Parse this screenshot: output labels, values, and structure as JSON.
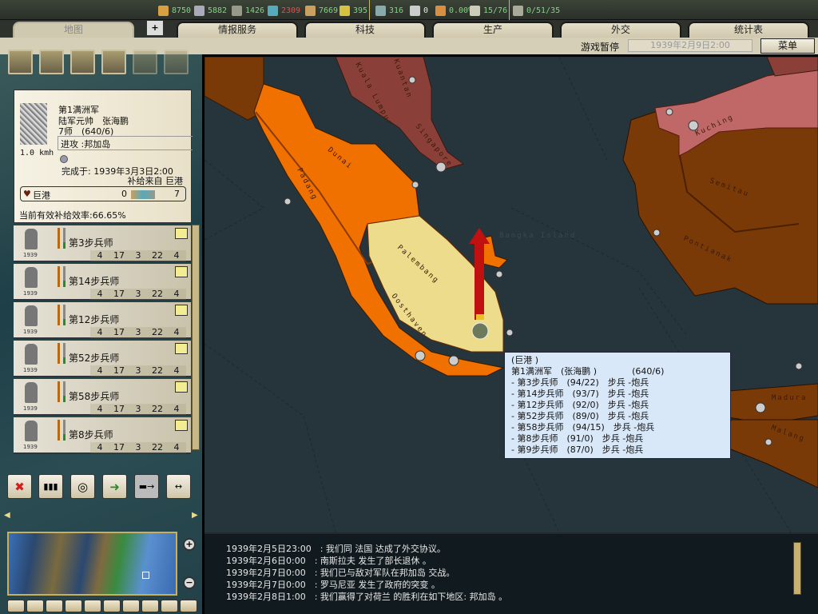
{
  "resources": [
    {
      "icon": "energy-icon",
      "value": "8750",
      "color": "#7fd67f"
    },
    {
      "icon": "metal-icon",
      "value": "5882",
      "color": "#7fd67f"
    },
    {
      "icon": "rare-materials-icon",
      "value": "1426",
      "color": "#7fd67f"
    },
    {
      "icon": "oil-icon",
      "value": "2309",
      "color": "#e05050"
    },
    {
      "icon": "supplies-icon",
      "value": "7669",
      "color": "#7fd67f"
    },
    {
      "icon": "money-icon",
      "value": "395",
      "color": "#7fd67f"
    },
    {
      "icon": "manpower-icon",
      "value": "316",
      "color": "#7fd67f"
    },
    {
      "icon": "transports-icon",
      "value": "0",
      "color": "#e8e8e8"
    },
    {
      "icon": "dissent-icon",
      "value": "0.00%",
      "color": "#7fd67f"
    },
    {
      "icon": "convoy-icon",
      "value": "15/76",
      "color": "#7fd67f"
    },
    {
      "icon": "nuke-icon",
      "value": "0/51/35",
      "color": "#7fd67f"
    }
  ],
  "tabs": [
    "地图",
    "情报服务",
    "科技",
    "生产",
    "外交",
    "统计表"
  ],
  "status": {
    "paused": "游戏暂停",
    "date": "1939年2月9日2:00",
    "menu": "菜单"
  },
  "unit": {
    "name": "第1满洲军",
    "rank_leader": "陆军元帅　张海鹏",
    "divisions": "7师　(640/6)",
    "mission": "进攻 :邦加岛",
    "speed": "1.0 kmh",
    "complete": "完成于: 1939年3月3日2:00",
    "supply_from": "补给来自 巨港",
    "province": "巨港",
    "supply_left": "0",
    "supply_right": "7",
    "efficiency": "当前有效补给效率:66.65%"
  },
  "division_list": [
    {
      "name": "第3步兵师",
      "year": "1939",
      "stats": [
        "4",
        "17",
        "3",
        "22",
        "4"
      ]
    },
    {
      "name": "第14步兵师",
      "year": "1939",
      "stats": [
        "4",
        "17",
        "3",
        "22",
        "4"
      ]
    },
    {
      "name": "第12步兵师",
      "year": "1939",
      "stats": [
        "4",
        "17",
        "3",
        "22",
        "4"
      ]
    },
    {
      "name": "第52步兵师",
      "year": "1939",
      "stats": [
        "4",
        "17",
        "3",
        "22",
        "4"
      ]
    },
    {
      "name": "第58步兵师",
      "year": "1939",
      "stats": [
        "4",
        "17",
        "3",
        "22",
        "4"
      ]
    },
    {
      "name": "第8步兵师",
      "year": "1939",
      "stats": [
        "4",
        "17",
        "3",
        "22",
        "4"
      ]
    }
  ],
  "map_labels": [
    "Dunai",
    "Padang",
    "Palembang",
    "Oosthaven",
    "Kuala Lumpur",
    "Kuantan",
    "Singapore",
    "Bangka Island",
    "Kuching",
    "Semitau",
    "Pontianak",
    "Madura",
    "Malang"
  ],
  "tooltip": {
    "lines": [
      "(巨港 )",
      "第1满洲军　(张海鹏 )　　　　(640/6)",
      "- 第3步兵师　(94/22)　步兵 -炮兵",
      "- 第14步兵师　(93/7)　步兵 -炮兵",
      "- 第12步兵师　(92/0)　步兵 -炮兵",
      "- 第52步兵师　(89/0)　步兵 -炮兵",
      "- 第58步兵师　(94/15)　步兵 -炮兵",
      "- 第8步兵师　(91/0)　步兵 -炮兵",
      "- 第9步兵师　(87/0)　步兵 -炮兵"
    ]
  },
  "log": [
    "1939年2月5日23:00　: 我们同 法国 达成了外交协议。",
    "1939年2月6日0:00　: 南斯拉夫 发生了部长退休 。",
    "1939年2月7日0:00　: 我们已与敌对军队在邦加岛 交战。",
    "1939年2月7日0:00　: 罗马尼亚 发生了政府的突变 。",
    "1939年2月8日1:00　: 我们赢得了对荷兰 的胜利在如下地区: 邦加岛 。"
  ]
}
